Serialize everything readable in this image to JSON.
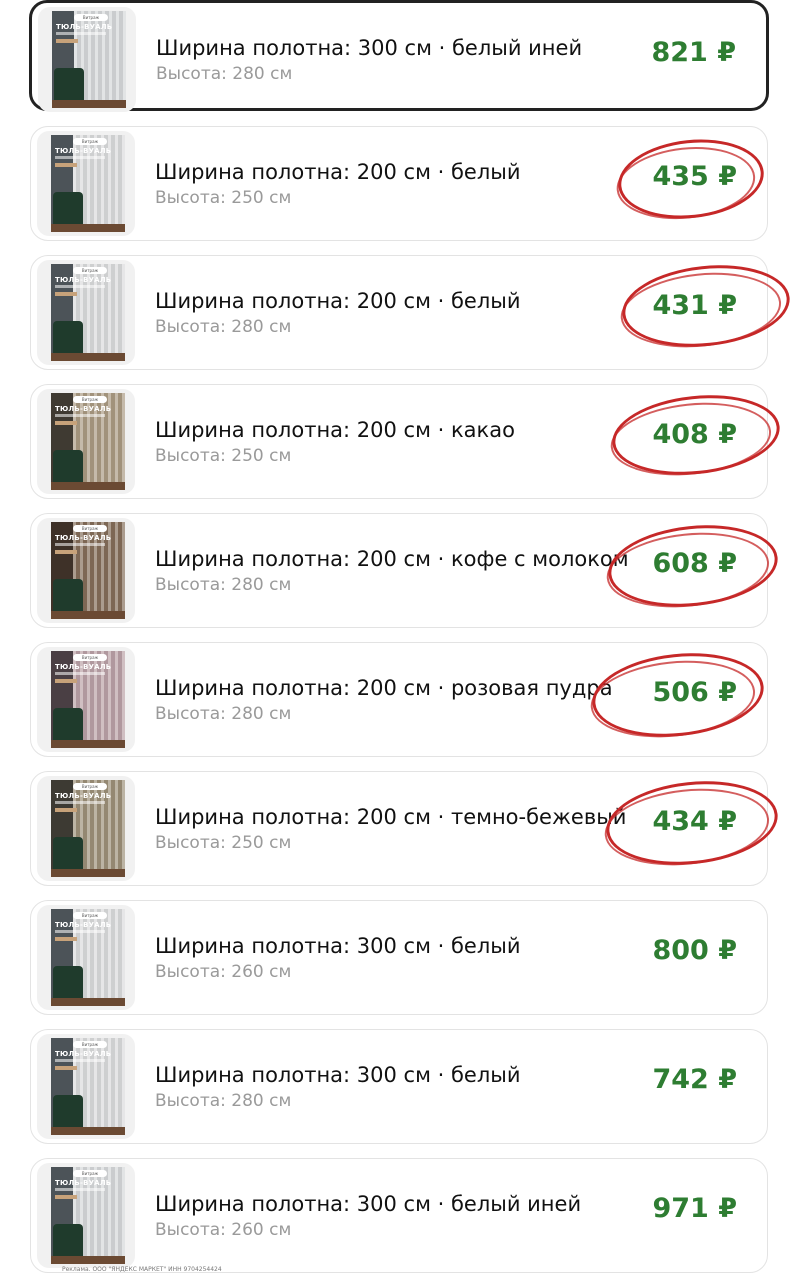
{
  "colors": {
    "price": "#2e7d32",
    "annotation": "#c62828",
    "selected_border": "#222222"
  },
  "items": [
    {
      "title": "Ширина полотна: 300 см · белый иней",
      "subtitle": "Высота: 280 см",
      "price": "821 ₽",
      "selected": true,
      "circled": false,
      "thumb": {
        "title": "ТЮЛЬ-ВУАЛЬ",
        "brand": "Витраж",
        "wall": "#4c5358",
        "curtain": "#e7e9ea"
      }
    },
    {
      "title": "Ширина полотна: 200 см · белый",
      "subtitle": "Высота: 250 см",
      "price": "435 ₽",
      "selected": false,
      "circled": true,
      "thumb": {
        "title": "ТЮЛЬ-ВУАЛЬ",
        "brand": "Витраж",
        "wall": "#4c5358",
        "curtain": "#eceeee"
      }
    },
    {
      "title": "Ширина полотна: 200 см · белый",
      "subtitle": "Высота: 280 см",
      "price": "431 ₽",
      "selected": false,
      "circled": true,
      "thumb": {
        "title": "ТЮЛЬ-ВУАЛЬ",
        "brand": "Витраж",
        "wall": "#4c5358",
        "curtain": "#eceeee"
      }
    },
    {
      "title": "Ширина полотна: 200 см · какао",
      "subtitle": "Высота: 250 см",
      "price": "408 ₽",
      "selected": false,
      "circled": true,
      "thumb": {
        "title": "ТЮЛЬ-ВУАЛЬ",
        "brand": "Витраж",
        "wall": "#3f3a32",
        "curtain": "#b8a88d"
      }
    },
    {
      "title": "Ширина полотна: 200 см · кофе с молоком",
      "subtitle": "Высота: 280 см",
      "price": "608 ₽",
      "selected": false,
      "circled": true,
      "thumb": {
        "title": "ТЮЛЬ-ВУАЛЬ",
        "brand": "Витраж",
        "wall": "#3e3128",
        "curtain": "#8e7560"
      }
    },
    {
      "title": "Ширина полотна: 200 см · розовая пудра",
      "subtitle": "Высота: 280 см",
      "price": "506 ₽",
      "selected": false,
      "circled": true,
      "thumb": {
        "title": "ТЮЛЬ-ВУАЛЬ",
        "brand": "Витраж",
        "wall": "#4a3f44",
        "curtain": "#c9aeb4"
      }
    },
    {
      "title": "Ширина полотна: 200 см · темно-бежевый",
      "subtitle": "Высота: 250 см",
      "price": "434 ₽",
      "selected": false,
      "circled": true,
      "thumb": {
        "title": "ТЮЛЬ-ВУАЛЬ",
        "brand": "Витраж",
        "wall": "#3d3a33",
        "curtain": "#a99c82"
      }
    },
    {
      "title": "Ширина полотна: 300 см · белый",
      "subtitle": "Высота: 260 см",
      "price": "800 ₽",
      "selected": false,
      "circled": false,
      "thumb": {
        "title": "ТЮЛЬ-ВУАЛЬ",
        "brand": "Витраж",
        "wall": "#4c5358",
        "curtain": "#eceeee"
      }
    },
    {
      "title": "Ширина полотна: 300 см · белый",
      "subtitle": "Высота: 280 см",
      "price": "742 ₽",
      "selected": false,
      "circled": false,
      "thumb": {
        "title": "ТЮЛЬ-ВУАЛЬ",
        "brand": "Витраж",
        "wall": "#4c5358",
        "curtain": "#eceeee"
      }
    },
    {
      "title": "Ширина полотна: 300 см · белый иней",
      "subtitle": "Высота: 260 см",
      "price": "971 ₽",
      "selected": false,
      "circled": false,
      "thumb": {
        "title": "ТЮЛЬ-ВУАЛЬ",
        "brand": "Витраж",
        "wall": "#4c5358",
        "curtain": "#e7e9ea"
      }
    }
  ],
  "footer": {
    "ad_text": "Реклама. ООО \"ЯНДЕКС МАРКЕТ\" ИНН 9704254424"
  }
}
